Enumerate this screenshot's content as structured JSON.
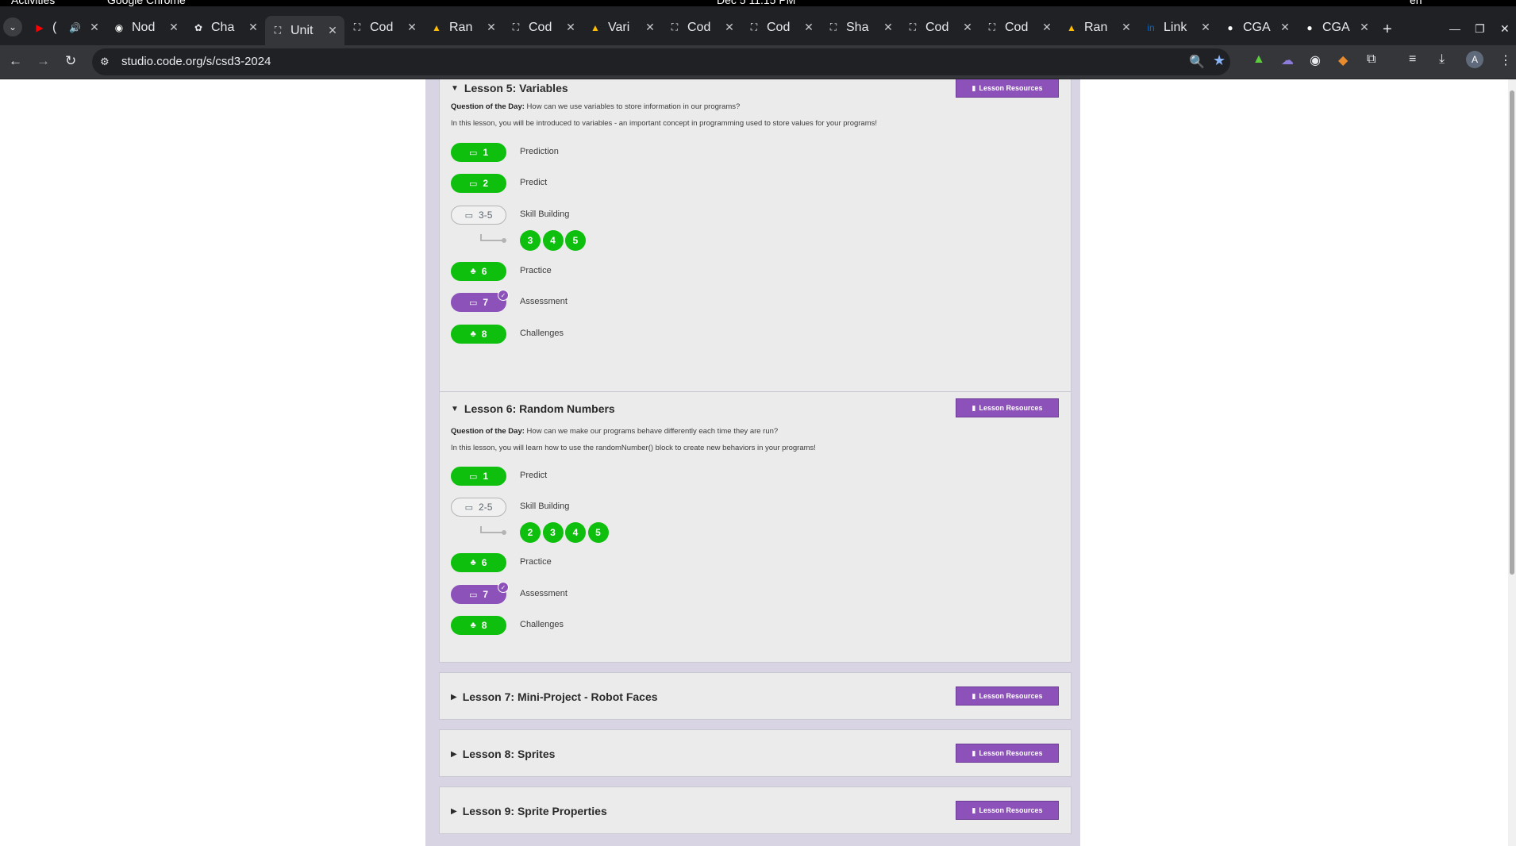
{
  "os": {
    "activities": "Activities",
    "app": "Google Chrome",
    "clock": "Dec 5  11:15 PM",
    "lang": "en"
  },
  "tabs": [
    {
      "title": "(",
      "icon": "youtube-icon",
      "extra": "🔊"
    },
    {
      "title": "Nod",
      "icon": "notion-icon"
    },
    {
      "title": "Cha",
      "icon": "chatgpt-icon"
    },
    {
      "title": "Unit",
      "icon": "codeorg-icon",
      "active": true
    },
    {
      "title": "Cod",
      "icon": "codeorg-icon"
    },
    {
      "title": "Ran",
      "icon": "drive-icon"
    },
    {
      "title": "Cod",
      "icon": "codeorg-icon"
    },
    {
      "title": "Vari",
      "icon": "drive-icon"
    },
    {
      "title": "Cod",
      "icon": "codeorg-icon"
    },
    {
      "title": "Cod",
      "icon": "codeorg-icon"
    },
    {
      "title": "Sha",
      "icon": "codeorg-icon"
    },
    {
      "title": "Cod",
      "icon": "codeorg-icon"
    },
    {
      "title": "Cod",
      "icon": "codeorg-icon"
    },
    {
      "title": "Ran",
      "icon": "drive-icon"
    },
    {
      "title": "Link",
      "icon": "linkedin-icon"
    },
    {
      "title": "CGA",
      "icon": "github-icon"
    },
    {
      "title": "CGA",
      "icon": "github-icon"
    }
  ],
  "address_bar": {
    "url": "studio.code.org/s/csd3-2024",
    "avatar": "A"
  },
  "lesson_resources_label": "Lesson Resources",
  "question_label": "Question of the Day:",
  "lessons": [
    {
      "title": "Lesson 5: Variables",
      "question": "How can we use variables to store information in our programs?",
      "description": "In this lesson, you will be introduced to variables - an important concept in programming used to store values for your programs!",
      "levels": [
        {
          "label": "1",
          "name": "Prediction",
          "style": "green",
          "icon": "monitor-icon"
        },
        {
          "label": "2",
          "name": "Predict",
          "style": "green",
          "icon": "monitor-icon"
        },
        {
          "label": "3-5",
          "name": "Skill Building",
          "style": "gray",
          "icon": "monitor-icon",
          "sublevels": [
            "3",
            "4",
            "5"
          ]
        },
        {
          "label": "6",
          "name": "Practice",
          "style": "green",
          "icon": "sitemap-icon"
        },
        {
          "label": "7",
          "name": "Assessment",
          "style": "purple",
          "icon": "monitor-icon",
          "check": true
        },
        {
          "label": "8",
          "name": "Challenges",
          "style": "green",
          "icon": "sitemap-icon"
        }
      ]
    },
    {
      "title": "Lesson 6: Random Numbers",
      "question": "How can we make our programs behave differently each time they are run?",
      "description": "In this lesson, you will learn how to use the randomNumber() block to create new behaviors in your programs!",
      "levels": [
        {
          "label": "1",
          "name": "Predict",
          "style": "green",
          "icon": "monitor-icon"
        },
        {
          "label": "2-5",
          "name": "Skill Building",
          "style": "gray",
          "icon": "monitor-icon",
          "sublevels": [
            "2",
            "3",
            "4",
            "5"
          ]
        },
        {
          "label": "6",
          "name": "Practice",
          "style": "green",
          "icon": "sitemap-icon"
        },
        {
          "label": "7",
          "name": "Assessment",
          "style": "purple",
          "icon": "monitor-icon",
          "check": true
        },
        {
          "label": "8",
          "name": "Challenges",
          "style": "green",
          "icon": "sitemap-icon"
        }
      ]
    },
    {
      "title": "Lesson 7: Mini-Project - Robot Faces"
    },
    {
      "title": "Lesson 8: Sprites"
    },
    {
      "title": "Lesson 9: Sprite Properties"
    }
  ],
  "colors": {
    "green": "#0ebf0e",
    "purple": "#8c52ba",
    "gray": "#b4b4b4"
  }
}
